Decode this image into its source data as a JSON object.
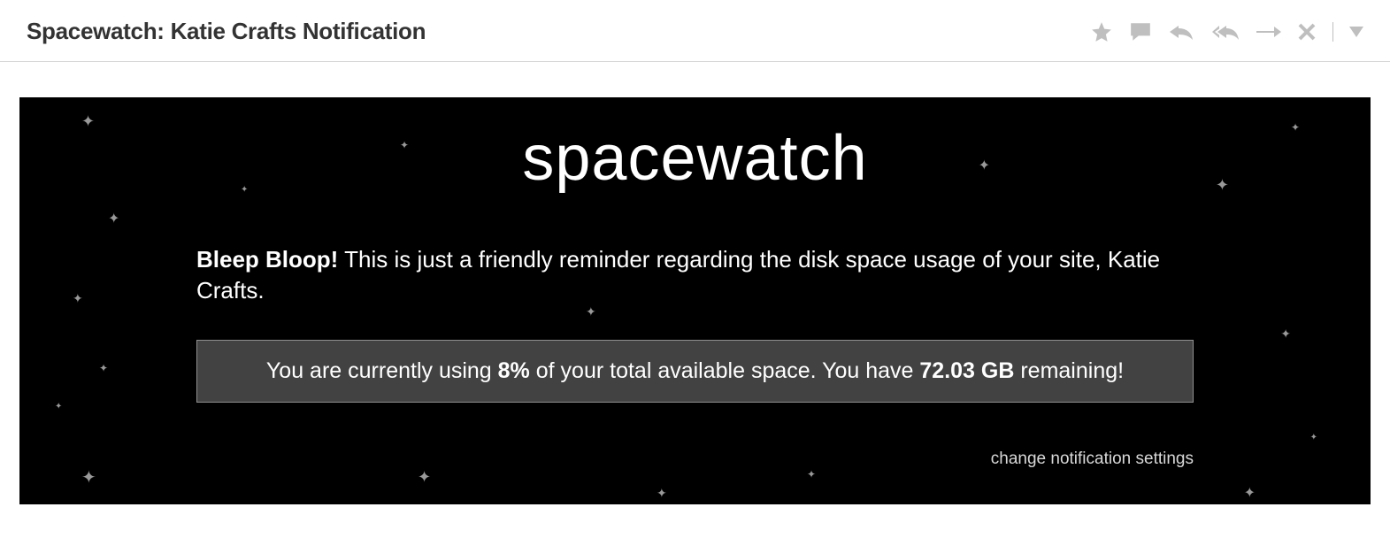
{
  "header": {
    "subject": "Spacewatch: Katie Crafts Notification"
  },
  "icons": {
    "star": "star-icon",
    "comment": "comment-icon",
    "reply": "reply-icon",
    "reply_all": "reply-all-icon",
    "forward": "forward-icon",
    "delete": "delete-icon",
    "more": "more-menu-icon"
  },
  "card": {
    "brand": "spacewatch",
    "greeting_bold": "Bleep Bloop!",
    "greeting_rest": " This is just a friendly reminder regarding the disk space usage of your site, Katie Crafts.",
    "usage_prefix": "You are currently using ",
    "usage_percent": "8%",
    "usage_mid": " of your total available space. You have ",
    "usage_remaining": "72.03 GB",
    "usage_suffix": " remaining!",
    "settings_link": "change notification settings"
  }
}
